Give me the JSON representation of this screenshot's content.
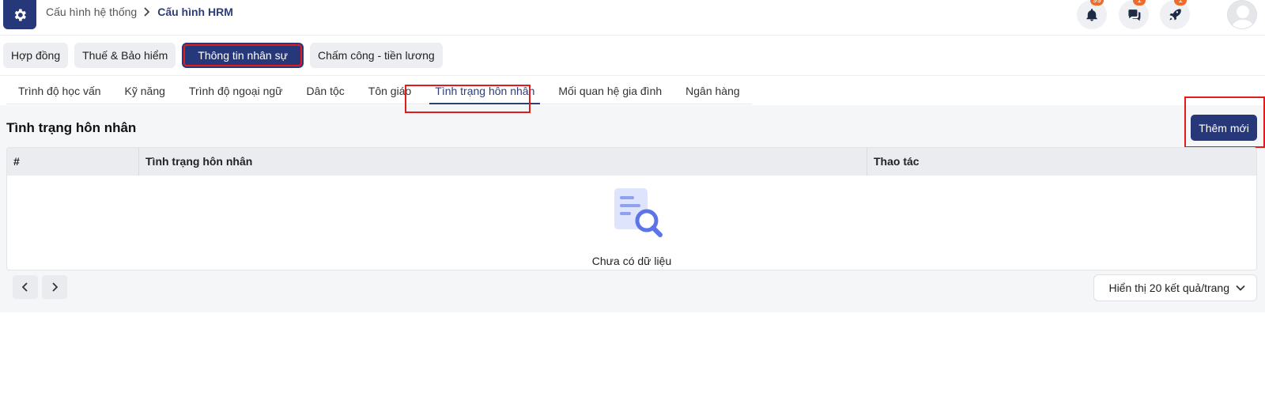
{
  "header": {
    "breadcrumb": [
      "Cấu hình hệ thống",
      "Cấu hình HRM"
    ],
    "notifications": {
      "icon": "bell-icon",
      "count": "99"
    },
    "messages": {
      "icon": "chat-icon",
      "count": "1"
    },
    "updates": {
      "icon": "rocket-icon",
      "count": "1"
    }
  },
  "top_tabs": [
    {
      "label": "Hợp đồng",
      "active": false
    },
    {
      "label": "Thuế & Bảo hiểm",
      "active": false
    },
    {
      "label": "Thông tin nhân sự",
      "active": true
    },
    {
      "label": "Chấm công - tiền lương",
      "active": false
    }
  ],
  "sub_tabs": [
    {
      "label": "Trình độ học vấn",
      "active": false
    },
    {
      "label": "Kỹ năng",
      "active": false
    },
    {
      "label": "Trình độ ngoại ngữ",
      "active": false
    },
    {
      "label": "Dân tộc",
      "active": false
    },
    {
      "label": "Tôn giáo",
      "active": false
    },
    {
      "label": "Tình trạng hôn nhân",
      "active": true
    },
    {
      "label": "Mối quan hệ gia đình",
      "active": false
    },
    {
      "label": "Ngân hàng",
      "active": false
    }
  ],
  "section": {
    "title": "Tình trạng hôn nhân",
    "add_label": "Thêm mới"
  },
  "table": {
    "columns": [
      "#",
      "Tình trạng hôn nhân",
      "Thao tác"
    ],
    "empty_text": "Chưa có dữ liệu"
  },
  "pagination": {
    "per_page_label": "Hiển thị 20 kết quả/trang"
  },
  "colors": {
    "primary": "#27387a",
    "highlight": "#e21c1c",
    "badge": "#f06b2a"
  }
}
